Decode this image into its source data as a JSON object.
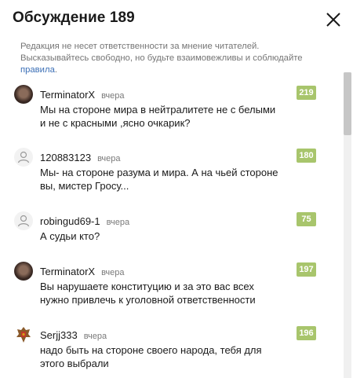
{
  "header": {
    "title": "Обсуждение 189"
  },
  "notice": {
    "text": "Редакция не несет ответственности за мнение читателей. Высказывайтесь свободно, но будьте взаимовежливы и соблюдайте ",
    "link": "правила",
    "end": "."
  },
  "comments": [
    {
      "user": "TerminatorX",
      "time": "вчера",
      "text": "Мы на стороне мира в нейтралитете не с белыми и не с красными ,ясно очкарик?",
      "rating": "219",
      "avatar": "photo"
    },
    {
      "user": "120883123",
      "time": "вчера",
      "text": "Мы- на стороне разума и мира. А на чьей стороне вы, мистер Гросу...",
      "rating": "180",
      "avatar": "default"
    },
    {
      "user": "robingud69-1",
      "time": "вчера",
      "text": "А судьи кто?",
      "rating": "75",
      "avatar": "default"
    },
    {
      "user": "TerminatorX",
      "time": "вчера",
      "text": "Вы нарушаете конституцию и за это вас всех нужно привлечь к уголовной ответственности",
      "rating": "197",
      "avatar": "photo"
    },
    {
      "user": "Serjj333",
      "time": "вчера",
      "text": "надо быть на стороне своего народа, тебя для этого выбрали",
      "rating": "196",
      "avatar": "crest"
    }
  ],
  "colors": {
    "accent_link": "#3b6fb6",
    "rating_bg": "#a8c56c",
    "muted_text": "#757575"
  }
}
